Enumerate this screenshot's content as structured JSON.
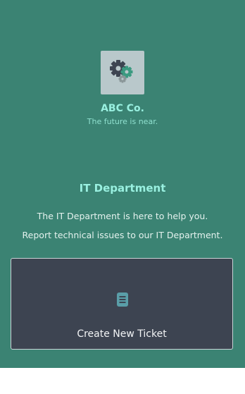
{
  "company": {
    "name": "ABC Co.",
    "tagline": "The future is near."
  },
  "department": {
    "title": "IT Department",
    "description_line1": "The IT Department is here to help you.",
    "description_line2": "Report technical issues to our IT Department."
  },
  "actions": {
    "create_ticket_label": "Create New Ticket"
  },
  "icons": {
    "logo": "gears-icon",
    "ticket": "document-icon"
  },
  "colors": {
    "background": "#3b8373",
    "accent_text": "#99f0e0",
    "card_background": "#3d4451",
    "logo_background": "#b9c8cb"
  }
}
